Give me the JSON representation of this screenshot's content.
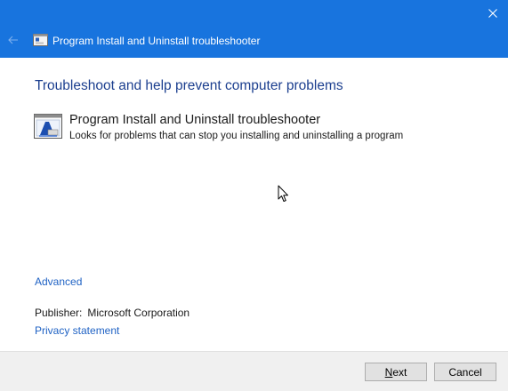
{
  "window": {
    "title": "Program Install and Uninstall troubleshooter",
    "icons": {
      "back": "back-arrow-icon",
      "close": "close-icon",
      "app": "troubleshooter-app-icon"
    },
    "colors": {
      "titlebar": "#1874de",
      "heading": "#1c3f8f",
      "link": "#1f62c4",
      "footer": "#f0f0f0"
    }
  },
  "main": {
    "heading": "Troubleshoot and help prevent computer problems",
    "item": {
      "title": "Program Install and Uninstall troubleshooter",
      "description": "Looks for problems that can stop you installing and uninstalling a program"
    },
    "advanced_link": "Advanced",
    "publisher_label": "Publisher:",
    "publisher_value": "Microsoft Corporation",
    "privacy_link": "Privacy statement"
  },
  "footer": {
    "next_key": "N",
    "next_rest": "ext",
    "cancel_label": "Cancel"
  }
}
